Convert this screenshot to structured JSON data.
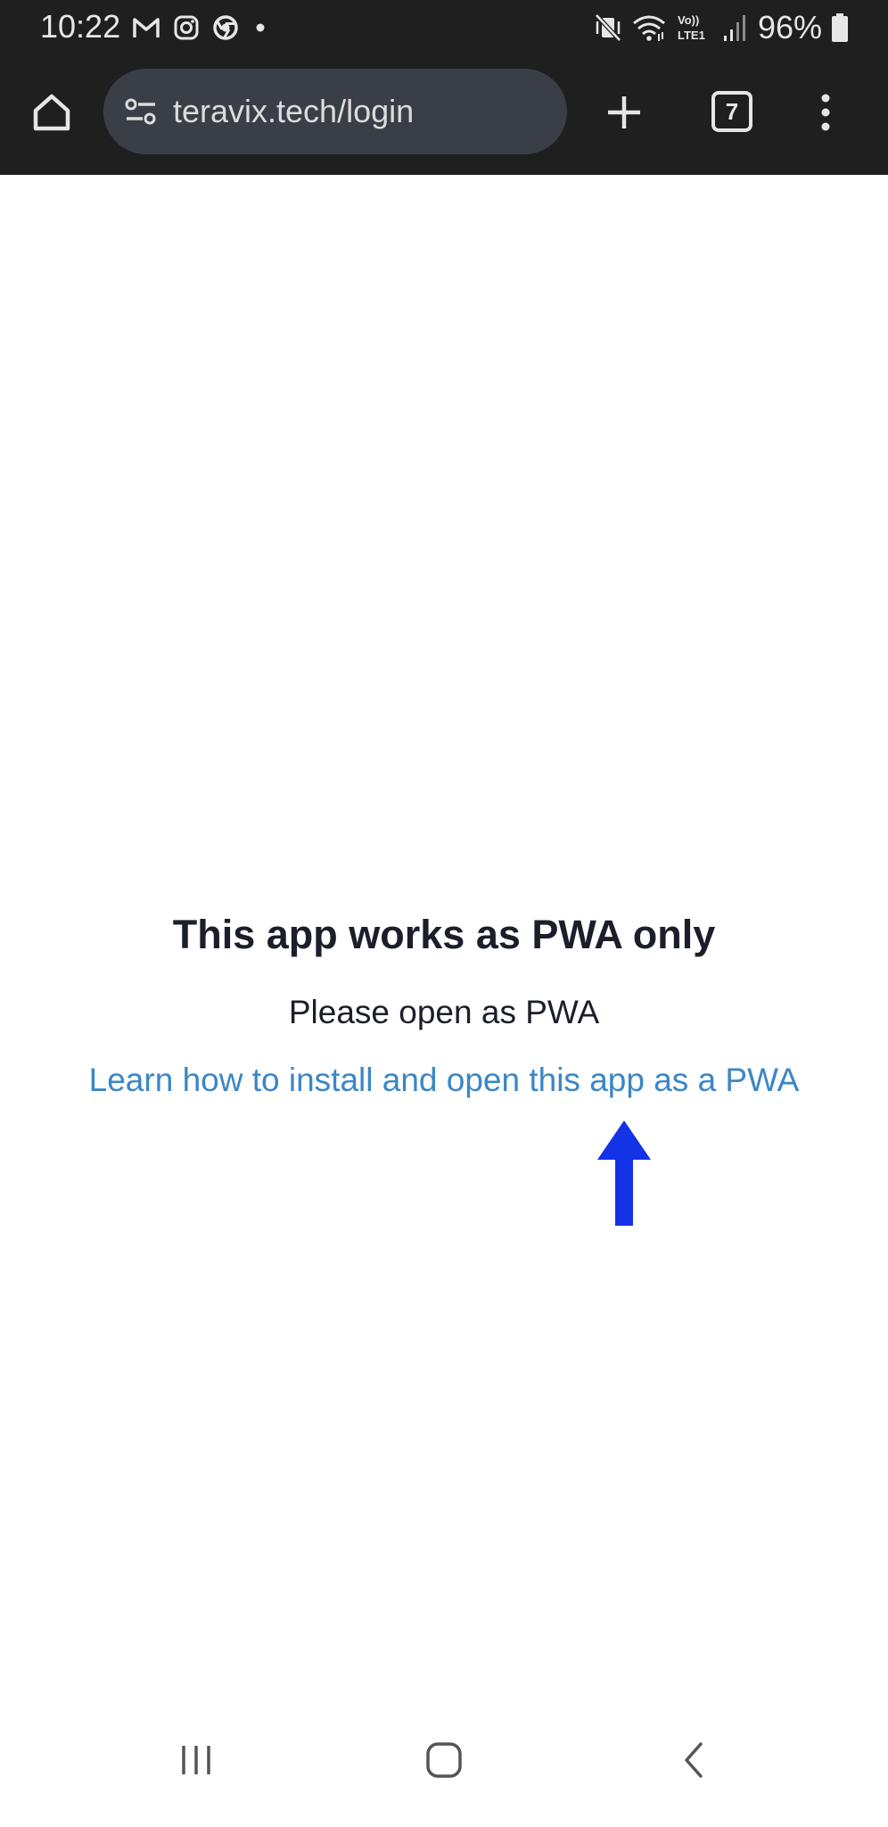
{
  "status_bar": {
    "time": "10:22",
    "battery": "96%",
    "left_icons": [
      "gmail-icon",
      "instagram-icon",
      "chrome-icon",
      "notification-dot-icon"
    ],
    "right_icons": [
      "vibrate-mute-icon",
      "wifi-icon",
      "volte-icon",
      "signal-icon",
      "battery-icon"
    ],
    "volte_label": "Vo)) LTE1"
  },
  "browser": {
    "url": "teravix.tech/login",
    "tab_count": "7"
  },
  "page": {
    "headline": "This app works as PWA only",
    "subline": "Please open as PWA",
    "link_text": "Learn how to install and open this app as a PWA"
  },
  "nav_bar": {
    "buttons": [
      "recent-apps",
      "home",
      "back"
    ]
  },
  "colors": {
    "status_bar_bg": "#1f1f1f",
    "url_bar_bg": "#3a3f47",
    "link": "#3b86c6",
    "arrow": "#1432e6",
    "heading_text": "#1b1f2a"
  }
}
